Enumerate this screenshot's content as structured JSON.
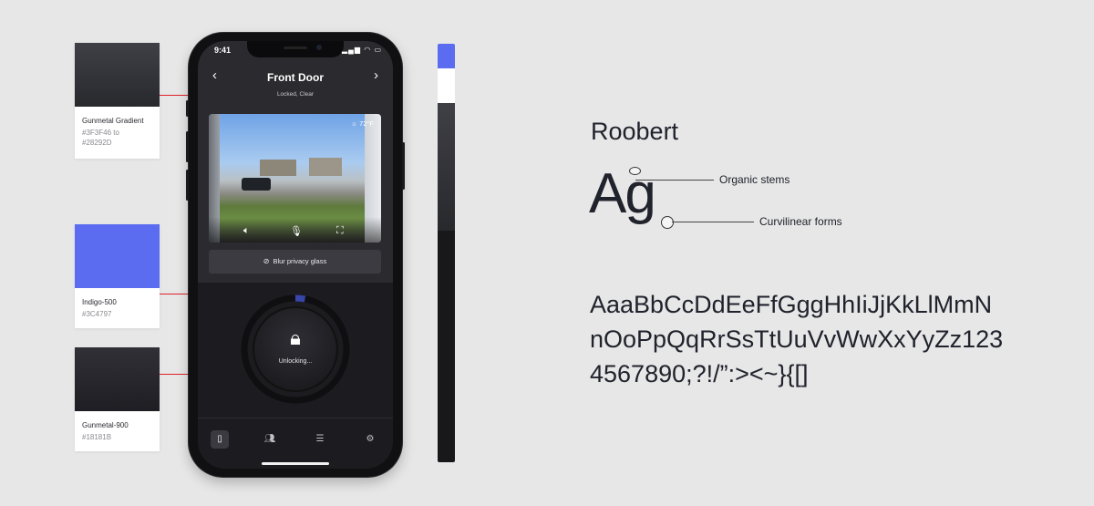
{
  "swatches": [
    {
      "name": "Gunmetal Gradient",
      "hex": "#3F3F46 to\n#28292D"
    },
    {
      "name": "Indigo-500",
      "hex": "#3C4797"
    },
    {
      "name": "Gunmetal-900",
      "hex": "#18181B"
    }
  ],
  "phone": {
    "status_time": "9:41",
    "status_icons": "signal-icon wifi-icon battery-icon",
    "header": {
      "title": "Front Door",
      "subtitle": "Locked, Clear",
      "back_icon": "‹",
      "next_icon": "›"
    },
    "camera": {
      "temperature": "72°F",
      "controls": [
        "speaker-icon",
        "microphone-icon",
        "fullscreen-icon"
      ]
    },
    "blur_button_label": "Blur privacy glass",
    "lock": {
      "status_label": "Unlocking...",
      "progress": 0.03
    },
    "tabs": [
      "door-icon",
      "users-icon",
      "list-icon",
      "settings-icon"
    ],
    "active_tab": 0
  },
  "colors": {
    "accent": "#5B6CF0",
    "gunmetal_start": "#3F3F46",
    "gunmetal_end": "#28292D",
    "gunmetal_900": "#18181B",
    "annotation_red": "#E0202A"
  },
  "typography": {
    "font_name": "Roobert",
    "specimen": "Ag",
    "annotations": [
      "Organic stems",
      "Curvilinear forms"
    ],
    "alphabet_lines": [
      "AaaBbCcDdEeFfGggHhIiJjKkLlMmN",
      "nOoPpQqRrSsTtUuVvWwXxYyZz123",
      "4567890;?!/”:><~}{[]"
    ]
  }
}
